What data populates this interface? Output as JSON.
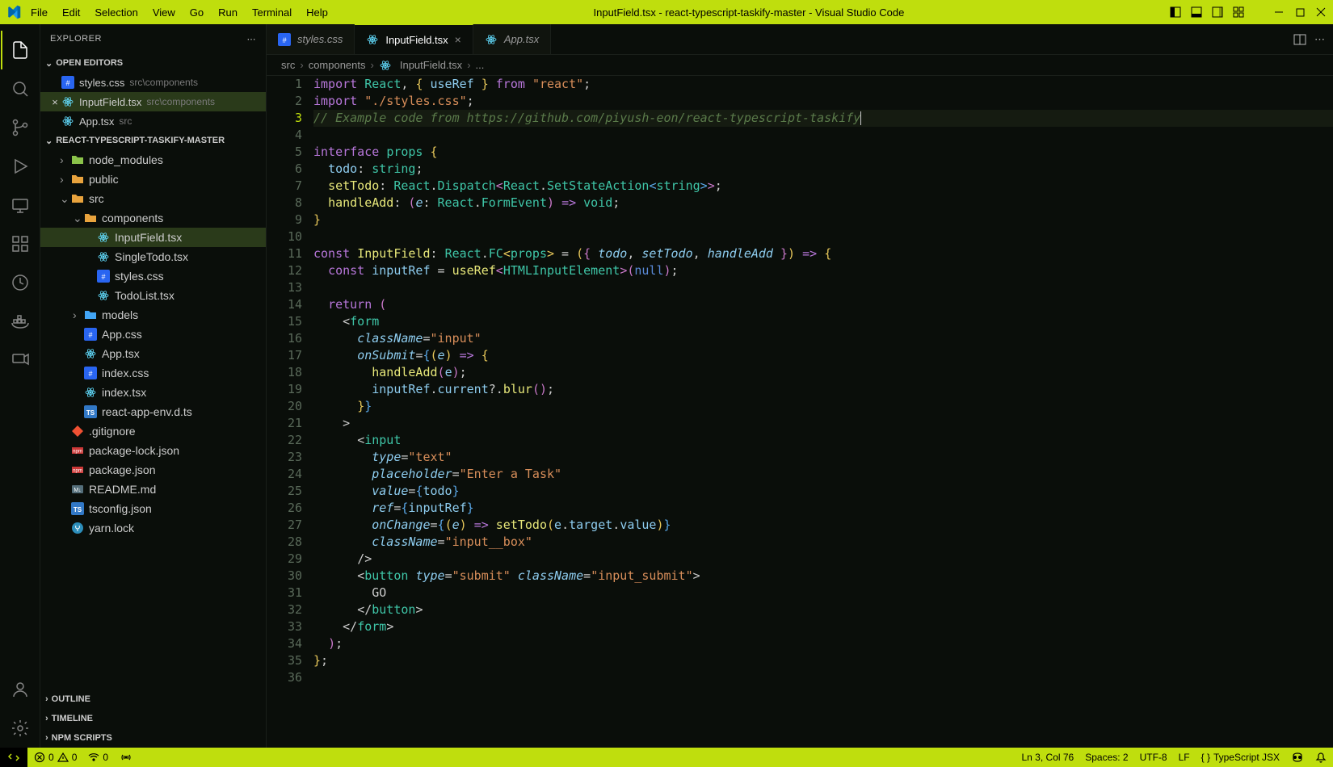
{
  "titlebar": {
    "menus": [
      "File",
      "Edit",
      "Selection",
      "View",
      "Go",
      "Run",
      "Terminal",
      "Help"
    ],
    "title": "InputField.tsx - react-typescript-taskify-master - Visual Studio Code"
  },
  "sidebar": {
    "header": "EXPLORER",
    "open_editors_label": "OPEN EDITORS",
    "open_editors": [
      {
        "name": "styles.css",
        "meta": "src\\components",
        "icon": "css"
      },
      {
        "name": "InputField.tsx",
        "meta": "src\\components",
        "icon": "react",
        "active": true,
        "close": true
      },
      {
        "name": "App.tsx",
        "meta": "src",
        "icon": "react"
      }
    ],
    "project_label": "REACT-TYPESCRIPT-TASKIFY-MASTER",
    "folders": [
      {
        "indent": 1,
        "chev": "›",
        "icon": "folder-green",
        "name": "node_modules"
      },
      {
        "indent": 1,
        "chev": "›",
        "icon": "folder-orange",
        "name": "public"
      },
      {
        "indent": 1,
        "chev": "⌄",
        "icon": "folder-orange",
        "name": "src"
      },
      {
        "indent": 2,
        "chev": "⌄",
        "icon": "folder-orange",
        "name": "components"
      },
      {
        "indent": 3,
        "icon": "react",
        "name": "InputField.tsx",
        "active": true
      },
      {
        "indent": 3,
        "icon": "react",
        "name": "SingleTodo.tsx"
      },
      {
        "indent": 3,
        "icon": "css",
        "name": "styles.css"
      },
      {
        "indent": 3,
        "icon": "react",
        "name": "TodoList.tsx"
      },
      {
        "indent": 2,
        "chev": "›",
        "icon": "folder-blue",
        "name": "models"
      },
      {
        "indent": 2,
        "icon": "css",
        "name": "App.css"
      },
      {
        "indent": 2,
        "icon": "react",
        "name": "App.tsx"
      },
      {
        "indent": 2,
        "icon": "css",
        "name": "index.css"
      },
      {
        "indent": 2,
        "icon": "react",
        "name": "index.tsx"
      },
      {
        "indent": 2,
        "icon": "ts",
        "name": "react-app-env.d.ts"
      },
      {
        "indent": 1,
        "icon": "git",
        "name": ".gitignore"
      },
      {
        "indent": 1,
        "icon": "npm",
        "name": "package-lock.json"
      },
      {
        "indent": 1,
        "icon": "npm",
        "name": "package.json"
      },
      {
        "indent": 1,
        "icon": "md",
        "name": "README.md"
      },
      {
        "indent": 1,
        "icon": "ts",
        "name": "tsconfig.json"
      },
      {
        "indent": 1,
        "icon": "yarn",
        "name": "yarn.lock"
      }
    ],
    "outline_label": "OUTLINE",
    "timeline_label": "TIMELINE",
    "npm_label": "NPM SCRIPTS"
  },
  "tabs": [
    {
      "name": "styles.css",
      "icon": "css"
    },
    {
      "name": "InputField.tsx",
      "icon": "react",
      "active": true
    },
    {
      "name": "App.tsx",
      "icon": "react"
    }
  ],
  "breadcrumbs": [
    "src",
    "components",
    "InputField.tsx",
    "..."
  ],
  "code_lines": [
    [
      {
        "c": "tok-kw",
        "t": "import"
      },
      {
        "c": "",
        "t": " "
      },
      {
        "c": "tok-type",
        "t": "React"
      },
      {
        "c": "",
        "t": ", "
      },
      {
        "c": "tok-brace1",
        "t": "{"
      },
      {
        "c": "",
        "t": " "
      },
      {
        "c": "tok-var",
        "t": "useRef"
      },
      {
        "c": "",
        "t": " "
      },
      {
        "c": "tok-brace1",
        "t": "}"
      },
      {
        "c": "",
        "t": " "
      },
      {
        "c": "tok-kw",
        "t": "from"
      },
      {
        "c": "",
        "t": " "
      },
      {
        "c": "tok-str",
        "t": "\"react\""
      },
      {
        "c": "",
        "t": ";"
      }
    ],
    [
      {
        "c": "tok-kw",
        "t": "import"
      },
      {
        "c": "",
        "t": " "
      },
      {
        "c": "tok-str",
        "t": "\"./styles.css\""
      },
      {
        "c": "",
        "t": ";"
      }
    ],
    [
      {
        "c": "tok-comment",
        "t": "// Example code from https://github.com/piyush-eon/react-typescript-taskify"
      }
    ],
    [],
    [
      {
        "c": "tok-kw",
        "t": "interface"
      },
      {
        "c": "",
        "t": " "
      },
      {
        "c": "tok-type",
        "t": "props"
      },
      {
        "c": "",
        "t": " "
      },
      {
        "c": "tok-brace1",
        "t": "{"
      }
    ],
    [
      {
        "c": "",
        "t": "  "
      },
      {
        "c": "tok-var",
        "t": "todo"
      },
      {
        "c": "",
        "t": ": "
      },
      {
        "c": "tok-type",
        "t": "string"
      },
      {
        "c": "",
        "t": ";"
      }
    ],
    [
      {
        "c": "",
        "t": "  "
      },
      {
        "c": "tok-func",
        "t": "setTodo"
      },
      {
        "c": "",
        "t": ": "
      },
      {
        "c": "tok-type",
        "t": "React"
      },
      {
        "c": "",
        "t": "."
      },
      {
        "c": "tok-type",
        "t": "Dispatch"
      },
      {
        "c": "tok-brace2",
        "t": "<"
      },
      {
        "c": "tok-type",
        "t": "React"
      },
      {
        "c": "",
        "t": "."
      },
      {
        "c": "tok-type",
        "t": "SetStateAction"
      },
      {
        "c": "tok-brace3",
        "t": "<"
      },
      {
        "c": "tok-type",
        "t": "string"
      },
      {
        "c": "tok-brace3",
        "t": ">"
      },
      {
        "c": "tok-brace2",
        "t": ">"
      },
      {
        "c": "",
        "t": ";"
      }
    ],
    [
      {
        "c": "",
        "t": "  "
      },
      {
        "c": "tok-func",
        "t": "handleAdd"
      },
      {
        "c": "",
        "t": ": "
      },
      {
        "c": "tok-brace2",
        "t": "("
      },
      {
        "c": "tok-param",
        "t": "e"
      },
      {
        "c": "",
        "t": ": "
      },
      {
        "c": "tok-type",
        "t": "React"
      },
      {
        "c": "",
        "t": "."
      },
      {
        "c": "tok-type",
        "t": "FormEvent"
      },
      {
        "c": "tok-brace2",
        "t": ")"
      },
      {
        "c": "",
        "t": " "
      },
      {
        "c": "tok-kw",
        "t": "=>"
      },
      {
        "c": "",
        "t": " "
      },
      {
        "c": "tok-type",
        "t": "void"
      },
      {
        "c": "",
        "t": ";"
      }
    ],
    [
      {
        "c": "tok-brace1",
        "t": "}"
      }
    ],
    [],
    [
      {
        "c": "tok-kw",
        "t": "const"
      },
      {
        "c": "",
        "t": " "
      },
      {
        "c": "tok-func",
        "t": "InputField"
      },
      {
        "c": "",
        "t": ": "
      },
      {
        "c": "tok-type",
        "t": "React"
      },
      {
        "c": "",
        "t": "."
      },
      {
        "c": "tok-type",
        "t": "FC"
      },
      {
        "c": "tok-brace1",
        "t": "<"
      },
      {
        "c": "tok-type",
        "t": "props"
      },
      {
        "c": "tok-brace1",
        "t": ">"
      },
      {
        "c": "",
        "t": " = "
      },
      {
        "c": "tok-brace1",
        "t": "("
      },
      {
        "c": "tok-brace2",
        "t": "{"
      },
      {
        "c": "",
        "t": " "
      },
      {
        "c": "tok-param",
        "t": "todo"
      },
      {
        "c": "",
        "t": ", "
      },
      {
        "c": "tok-param",
        "t": "setTodo"
      },
      {
        "c": "",
        "t": ", "
      },
      {
        "c": "tok-param",
        "t": "handleAdd"
      },
      {
        "c": "",
        "t": " "
      },
      {
        "c": "tok-brace2",
        "t": "}"
      },
      {
        "c": "tok-brace1",
        "t": ")"
      },
      {
        "c": "",
        "t": " "
      },
      {
        "c": "tok-kw",
        "t": "=>"
      },
      {
        "c": "",
        "t": " "
      },
      {
        "c": "tok-brace1",
        "t": "{"
      }
    ],
    [
      {
        "c": "",
        "t": "  "
      },
      {
        "c": "tok-kw",
        "t": "const"
      },
      {
        "c": "",
        "t": " "
      },
      {
        "c": "tok-var",
        "t": "inputRef"
      },
      {
        "c": "",
        "t": " = "
      },
      {
        "c": "tok-func",
        "t": "useRef"
      },
      {
        "c": "tok-brace2",
        "t": "<"
      },
      {
        "c": "tok-type",
        "t": "HTMLInputElement"
      },
      {
        "c": "tok-brace2",
        "t": ">"
      },
      {
        "c": "tok-brace2",
        "t": "("
      },
      {
        "c": "tok-null",
        "t": "null"
      },
      {
        "c": "tok-brace2",
        "t": ")"
      },
      {
        "c": "",
        "t": ";"
      }
    ],
    [],
    [
      {
        "c": "",
        "t": "  "
      },
      {
        "c": "tok-kw",
        "t": "return"
      },
      {
        "c": "",
        "t": " "
      },
      {
        "c": "tok-brace2",
        "t": "("
      }
    ],
    [
      {
        "c": "",
        "t": "    "
      },
      {
        "c": "tok-punc",
        "t": "<"
      },
      {
        "c": "tok-type",
        "t": "form"
      }
    ],
    [
      {
        "c": "",
        "t": "      "
      },
      {
        "c": "tok-attr",
        "t": "className"
      },
      {
        "c": "",
        "t": "="
      },
      {
        "c": "tok-str",
        "t": "\"input\""
      }
    ],
    [
      {
        "c": "",
        "t": "      "
      },
      {
        "c": "tok-attr",
        "t": "onSubmit"
      },
      {
        "c": "",
        "t": "="
      },
      {
        "c": "tok-brace3",
        "t": "{"
      },
      {
        "c": "tok-brace1",
        "t": "("
      },
      {
        "c": "tok-param",
        "t": "e"
      },
      {
        "c": "tok-brace1",
        "t": ")"
      },
      {
        "c": "",
        "t": " "
      },
      {
        "c": "tok-kw",
        "t": "=>"
      },
      {
        "c": "",
        "t": " "
      },
      {
        "c": "tok-brace1",
        "t": "{"
      }
    ],
    [
      {
        "c": "",
        "t": "        "
      },
      {
        "c": "tok-func",
        "t": "handleAdd"
      },
      {
        "c": "tok-brace2",
        "t": "("
      },
      {
        "c": "tok-var",
        "t": "e"
      },
      {
        "c": "tok-brace2",
        "t": ")"
      },
      {
        "c": "",
        "t": ";"
      }
    ],
    [
      {
        "c": "",
        "t": "        "
      },
      {
        "c": "tok-var",
        "t": "inputRef"
      },
      {
        "c": "",
        "t": "."
      },
      {
        "c": "tok-var",
        "t": "current"
      },
      {
        "c": "",
        "t": "?."
      },
      {
        "c": "tok-func",
        "t": "blur"
      },
      {
        "c": "tok-brace2",
        "t": "()"
      },
      {
        "c": "",
        "t": ";"
      }
    ],
    [
      {
        "c": "",
        "t": "      "
      },
      {
        "c": "tok-brace1",
        "t": "}"
      },
      {
        "c": "tok-brace3",
        "t": "}"
      }
    ],
    [
      {
        "c": "",
        "t": "    "
      },
      {
        "c": "tok-punc",
        "t": ">"
      }
    ],
    [
      {
        "c": "",
        "t": "      "
      },
      {
        "c": "tok-punc",
        "t": "<"
      },
      {
        "c": "tok-type",
        "t": "input"
      }
    ],
    [
      {
        "c": "",
        "t": "        "
      },
      {
        "c": "tok-attr",
        "t": "type"
      },
      {
        "c": "",
        "t": "="
      },
      {
        "c": "tok-str",
        "t": "\"text\""
      }
    ],
    [
      {
        "c": "",
        "t": "        "
      },
      {
        "c": "tok-attr",
        "t": "placeholder"
      },
      {
        "c": "",
        "t": "="
      },
      {
        "c": "tok-str",
        "t": "\"Enter a Task\""
      }
    ],
    [
      {
        "c": "",
        "t": "        "
      },
      {
        "c": "tok-attr",
        "t": "value"
      },
      {
        "c": "",
        "t": "="
      },
      {
        "c": "tok-brace3",
        "t": "{"
      },
      {
        "c": "tok-var",
        "t": "todo"
      },
      {
        "c": "tok-brace3",
        "t": "}"
      }
    ],
    [
      {
        "c": "",
        "t": "        "
      },
      {
        "c": "tok-attr",
        "t": "ref"
      },
      {
        "c": "",
        "t": "="
      },
      {
        "c": "tok-brace3",
        "t": "{"
      },
      {
        "c": "tok-var",
        "t": "inputRef"
      },
      {
        "c": "tok-brace3",
        "t": "}"
      }
    ],
    [
      {
        "c": "",
        "t": "        "
      },
      {
        "c": "tok-attr",
        "t": "onChange"
      },
      {
        "c": "",
        "t": "="
      },
      {
        "c": "tok-brace3",
        "t": "{"
      },
      {
        "c": "tok-brace1",
        "t": "("
      },
      {
        "c": "tok-param",
        "t": "e"
      },
      {
        "c": "tok-brace1",
        "t": ")"
      },
      {
        "c": "",
        "t": " "
      },
      {
        "c": "tok-kw",
        "t": "=>"
      },
      {
        "c": "",
        "t": " "
      },
      {
        "c": "tok-func",
        "t": "setTodo"
      },
      {
        "c": "tok-brace1",
        "t": "("
      },
      {
        "c": "tok-var",
        "t": "e"
      },
      {
        "c": "",
        "t": "."
      },
      {
        "c": "tok-var",
        "t": "target"
      },
      {
        "c": "",
        "t": "."
      },
      {
        "c": "tok-var",
        "t": "value"
      },
      {
        "c": "tok-brace1",
        "t": ")"
      },
      {
        "c": "tok-brace3",
        "t": "}"
      }
    ],
    [
      {
        "c": "",
        "t": "        "
      },
      {
        "c": "tok-attr",
        "t": "className"
      },
      {
        "c": "",
        "t": "="
      },
      {
        "c": "tok-str",
        "t": "\"input__box\""
      }
    ],
    [
      {
        "c": "",
        "t": "      "
      },
      {
        "c": "tok-punc",
        "t": "/>"
      }
    ],
    [
      {
        "c": "",
        "t": "      "
      },
      {
        "c": "tok-punc",
        "t": "<"
      },
      {
        "c": "tok-type",
        "t": "button"
      },
      {
        "c": "",
        "t": " "
      },
      {
        "c": "tok-attr",
        "t": "type"
      },
      {
        "c": "",
        "t": "="
      },
      {
        "c": "tok-str",
        "t": "\"submit\""
      },
      {
        "c": "",
        "t": " "
      },
      {
        "c": "tok-attr",
        "t": "className"
      },
      {
        "c": "",
        "t": "="
      },
      {
        "c": "tok-str",
        "t": "\"input_submit\""
      },
      {
        "c": "tok-punc",
        "t": ">"
      }
    ],
    [
      {
        "c": "",
        "t": "        GO"
      }
    ],
    [
      {
        "c": "",
        "t": "      "
      },
      {
        "c": "tok-punc",
        "t": "</"
      },
      {
        "c": "tok-type",
        "t": "button"
      },
      {
        "c": "tok-punc",
        "t": ">"
      }
    ],
    [
      {
        "c": "",
        "t": "    "
      },
      {
        "c": "tok-punc",
        "t": "</"
      },
      {
        "c": "tok-type",
        "t": "form"
      },
      {
        "c": "tok-punc",
        "t": ">"
      }
    ],
    [
      {
        "c": "",
        "t": "  "
      },
      {
        "c": "tok-brace2",
        "t": ")"
      },
      {
        "c": "",
        "t": ";"
      }
    ],
    [
      {
        "c": "tok-brace1",
        "t": "}"
      },
      {
        "c": "",
        "t": ";"
      }
    ],
    []
  ],
  "current_line": 3,
  "statusbar": {
    "errors": "0",
    "warnings": "0",
    "port": "0",
    "ln_col": "Ln 3, Col 76",
    "spaces": "Spaces: 2",
    "encoding": "UTF-8",
    "eol": "LF",
    "lang": "TypeScript JSX"
  }
}
